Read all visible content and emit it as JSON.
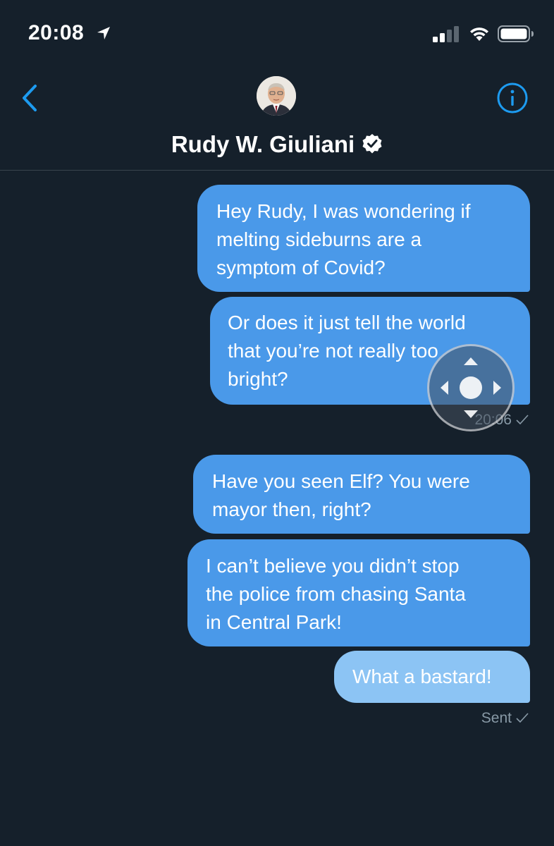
{
  "status_bar": {
    "time": "20:08",
    "icons": [
      "location-arrow-icon",
      "cellular-signal-icon",
      "wifi-icon",
      "battery-icon"
    ]
  },
  "header": {
    "contact_name": "Rudy W. Giuliani",
    "icons": [
      "back-chevron-icon",
      "info-icon",
      "verified-badge-icon"
    ]
  },
  "colors": {
    "background": "#15202b",
    "bubble": "#4a99e9",
    "bubble_light": "#8cc4f4",
    "accent": "#1d9bf0",
    "meta": "#8899a6"
  },
  "messages": [
    {
      "text": "Hey Rudy, I was wondering if\nmelting sideburns are a\nsymptom of Covid?"
    },
    {
      "text": "Or does it just tell the world\nthat you’re not really too\nbright?"
    },
    {
      "text": "Have you seen Elf?  You were\nmayor then, right?"
    },
    {
      "text": "I can’t believe you didn’t stop\nthe police from chasing Santa\nin Central Park!"
    },
    {
      "text": "What a bastard!"
    }
  ],
  "meta": {
    "timestamp_1": "20:06",
    "status_2": "Sent"
  }
}
